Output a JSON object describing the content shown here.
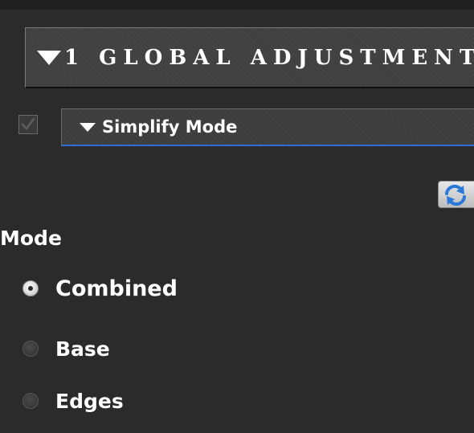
{
  "panel": {
    "section": {
      "title": "1 GLOBAL ADJUSTMENT"
    },
    "subsection": {
      "title": "Simplify Mode",
      "enabled": true
    },
    "reset_button": {
      "icon": "refresh-icon"
    },
    "mode": {
      "label": "Mode",
      "selected": "Combined",
      "options": [
        {
          "label": "Combined",
          "checked": true
        },
        {
          "label": "Base",
          "checked": false
        },
        {
          "label": "Edges",
          "checked": false
        }
      ]
    }
  },
  "colors": {
    "background": "#2b2b2b",
    "header_background": "#404040",
    "accent_underline": "#2f6fd0",
    "refresh_icon_blue": "#2a78d8",
    "text": "#ffffff"
  }
}
